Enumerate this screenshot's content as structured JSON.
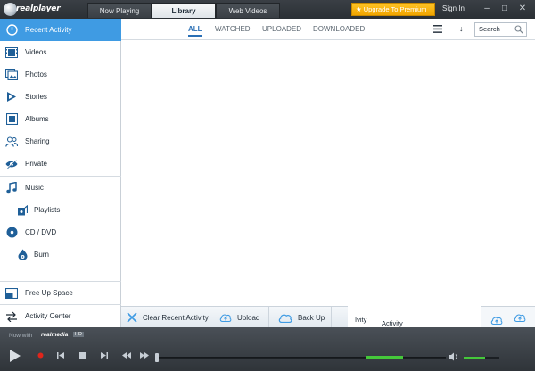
{
  "app": {
    "logo_text": "realplayer"
  },
  "tabs": [
    {
      "label": "Now Playing"
    },
    {
      "label": "Library"
    },
    {
      "label": "Web Videos"
    }
  ],
  "header": {
    "upgrade_label": "Upgrade To Premium",
    "signin_label": "Sign In",
    "window_buttons": [
      "minimize",
      "maximize",
      "close"
    ]
  },
  "sidebar": {
    "items": [
      {
        "label": "Recent Activity",
        "icon": "clock-icon"
      },
      {
        "label": "Videos",
        "icon": "film-icon"
      },
      {
        "label": "Photos",
        "icon": "photos-icon"
      },
      {
        "label": "Stories",
        "icon": "stories-icon"
      },
      {
        "label": "Albums",
        "icon": "albums-icon"
      },
      {
        "label": "Sharing",
        "icon": "people-icon"
      },
      {
        "label": "Private",
        "icon": "eye-off-icon"
      },
      {
        "label": "Music",
        "icon": "music-note-icon"
      },
      {
        "label": "Playlists",
        "icon": "playlist-icon"
      },
      {
        "label": "CD / DVD",
        "icon": "disc-icon"
      },
      {
        "label": "Burn",
        "icon": "burn-icon"
      },
      {
        "label": "Free Up Space",
        "icon": "free-space-icon"
      },
      {
        "label": "Activity Center",
        "icon": "activity-arrows-icon"
      }
    ]
  },
  "filters": {
    "items": [
      "ALL",
      "WATCHED",
      "UPLOADED",
      "DOWNLOADED"
    ],
    "active": "ALL",
    "search_placeholder": "Search"
  },
  "toolbar": {
    "clear_label": "Clear Recent Activity",
    "upload_label": "Upload",
    "backup_label": "Back Up",
    "torn_label_1": "Ivity",
    "torn_label_2": "Activity"
  },
  "player": {
    "now_with": "Now with",
    "brand": "realmedia",
    "badge": "HD",
    "seek_position": 0,
    "volume_level": 0.6,
    "accent_color": "#45c83a"
  },
  "colors": {
    "accent": "#3f9be3",
    "upgrade": "#f1a500"
  }
}
